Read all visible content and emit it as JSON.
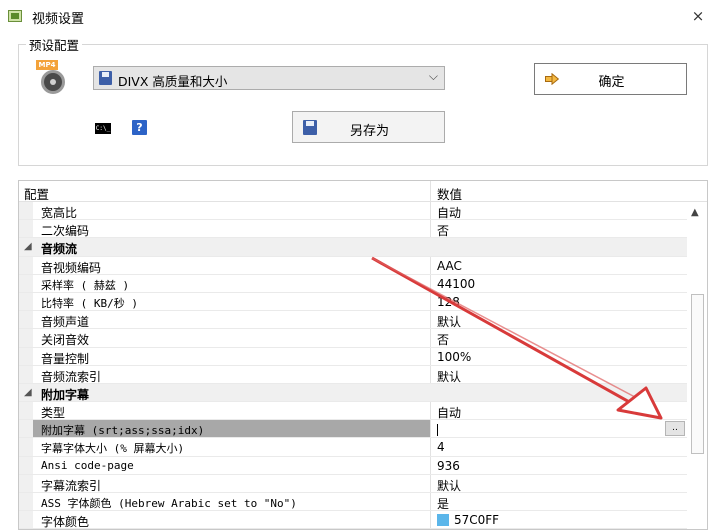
{
  "window": {
    "title": "视频设置",
    "close_glyph": "×"
  },
  "preset": {
    "group_label": "预设配置",
    "selected": "DIVX 高质量和大小",
    "ok_label": "确定",
    "save_as_label": "另存为",
    "cmd_glyph": "C:\\_",
    "help_glyph": "?"
  },
  "grid": {
    "header_name": "配置",
    "header_value": "数值",
    "rows": [
      {
        "type": "prop",
        "name": "宽高比",
        "value": "自动"
      },
      {
        "type": "prop",
        "name": "二次编码",
        "value": "否"
      },
      {
        "type": "cat",
        "name": "音频流",
        "glyph": "◢"
      },
      {
        "type": "prop",
        "name": "音视频编码",
        "value": "AAC"
      },
      {
        "type": "prop",
        "name": "采样率 ( 赫兹 )",
        "value": "44100"
      },
      {
        "type": "prop",
        "name": "比特率 ( KB/秒 )",
        "value": "128"
      },
      {
        "type": "prop",
        "name": "音频声道",
        "value": "默认"
      },
      {
        "type": "prop",
        "name": "关闭音效",
        "value": "否"
      },
      {
        "type": "prop",
        "name": "音量控制",
        "value": "100%"
      },
      {
        "type": "prop",
        "name": "音频流索引",
        "value": "默认"
      },
      {
        "type": "cat",
        "name": "附加字幕",
        "glyph": "◢"
      },
      {
        "type": "prop",
        "name": "类型",
        "value": "自动"
      },
      {
        "type": "sel",
        "name": "附加字幕 (srt;ass;ssa;idx)",
        "value": "",
        "button": ".."
      },
      {
        "type": "prop",
        "name": "字幕字体大小 (% 屏幕大小)",
        "value": "4"
      },
      {
        "type": "prop",
        "name": "Ansi code-page",
        "value": "936"
      },
      {
        "type": "prop",
        "name": "字幕流索引",
        "value": "默认"
      },
      {
        "type": "prop",
        "name": "ASS 字体颜色 (Hebrew Arabic set to \"No\")",
        "value": "是"
      },
      {
        "type": "color",
        "name": "字体颜色",
        "value": "57C0FF",
        "swatch": "#5bb6ea"
      }
    ]
  },
  "colors": {
    "annotation_arrow": "#d83a3a",
    "selection": "#a8a8a8"
  }
}
